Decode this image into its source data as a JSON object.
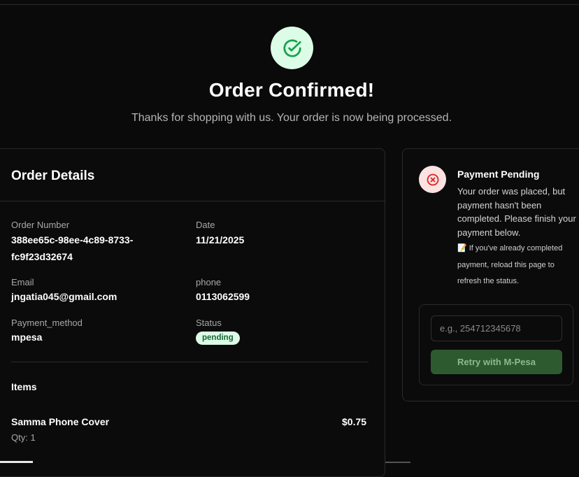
{
  "header": {
    "title": "Order Confirmed!",
    "subtitle": "Thanks for shopping with us. Your order is now being processed.",
    "icon": "check-circle-icon"
  },
  "details": {
    "title": "Order Details",
    "order_number_label": "Order Number",
    "order_number_line1": "388ee65c-98ee-4c89-8733-",
    "order_number_line2": "fc9f23d32674",
    "date_label": "Date",
    "date": "11/21/2025",
    "email_label": "Email",
    "email": "jngatia045@gmail.com",
    "phone_label": "phone",
    "phone": "0113062599",
    "payment_method_label": "Payment_method",
    "payment_method": "mpesa",
    "status_label": "Status",
    "status": "pending",
    "items_title": "Items",
    "items": [
      {
        "name": "Samma Phone Cover",
        "qty": "Qty: 1",
        "price": "$0.75"
      }
    ]
  },
  "payment": {
    "icon": "x-circle-icon",
    "title": "Payment Pending",
    "text": "Your order was placed, but payment hasn't been completed. Please finish your payment below.",
    "note": "📝 If you've already completed payment, reload this page to refresh the status.",
    "phone_placeholder": "e.g., 254712345678",
    "retry_label": "Retry with M-Pesa"
  },
  "colors": {
    "background": "#0a0a0a",
    "success_bg": "#dcfce7",
    "success_fg": "#16a34a",
    "error_bg": "#fde2e2",
    "error_fg": "#dc2626",
    "button_bg": "#2e5a2f"
  }
}
